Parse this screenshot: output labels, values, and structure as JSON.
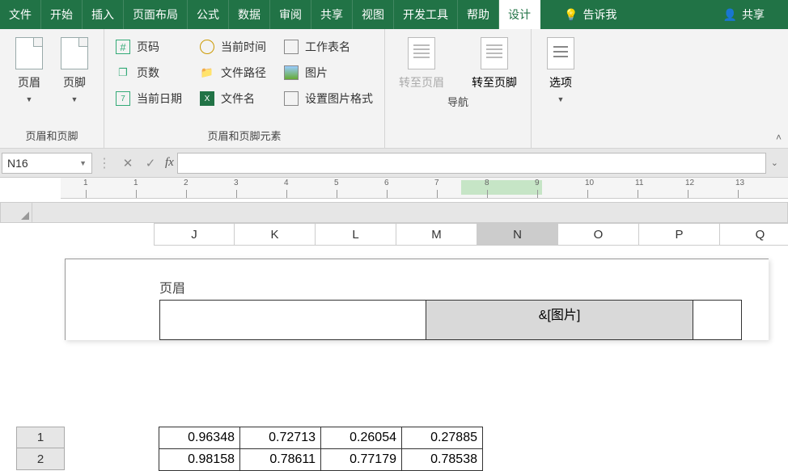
{
  "tabs": {
    "file": "文件",
    "home": "开始",
    "insert": "插入",
    "layout": "页面布局",
    "formulas": "公式",
    "data": "数据",
    "review": "审阅",
    "share1": "共享",
    "view": "视图",
    "dev": "开发工具",
    "help": "帮助",
    "design": "设计",
    "tellme": "告诉我",
    "share2": "共享"
  },
  "ribbon": {
    "group1_label": "页眉和页脚",
    "header_btn": "页眉",
    "footer_btn": "页脚",
    "group2_label": "页眉和页脚元素",
    "pagecode": "页码",
    "pagecount": "页数",
    "currentdate": "当前日期",
    "currenttime": "当前时间",
    "filepath": "文件路径",
    "filename": "文件名",
    "sheetname": "工作表名",
    "picture": "图片",
    "fmtpic": "设置图片格式",
    "group3_label": "导航",
    "goheader": "转至页眉",
    "gofooter": "转至页脚",
    "options": "选项"
  },
  "namebox": "N16",
  "columns": [
    "J",
    "K",
    "L",
    "M",
    "N",
    "O",
    "P",
    "Q"
  ],
  "ruler_marks": [
    "1",
    "1",
    "2",
    "3",
    "4",
    "5",
    "6",
    "7",
    "8",
    "9",
    "10",
    "11",
    "12",
    "13"
  ],
  "header_section_label": "页眉",
  "header_center_content": "&[图片]",
  "rows": [
    "1",
    "2"
  ],
  "chart_data": {
    "type": "table",
    "columns": [
      "J",
      "K",
      "L",
      "M"
    ],
    "rows": [
      [
        0.96348,
        0.72713,
        0.26054,
        0.27885
      ],
      [
        0.98158,
        0.78611,
        0.77179,
        0.78538
      ]
    ]
  }
}
